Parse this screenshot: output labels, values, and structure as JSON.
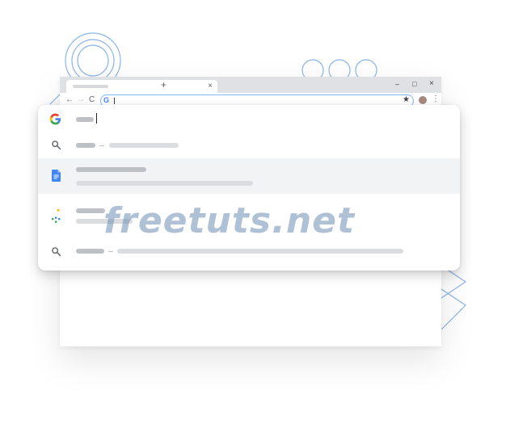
{
  "browser": {
    "tab_close_glyph": "×",
    "new_tab_glyph": "+",
    "window_controls": {
      "minimize_glyph": "–",
      "maximize_glyph": "□",
      "close_glyph": "×"
    },
    "toolbar": {
      "back_icon": "←",
      "forward_icon": "→",
      "reload_icon": "C",
      "omnibox_logo": "G",
      "bookmark_icon": "★",
      "menu_icon": "⋮"
    }
  },
  "suggestions": [
    {
      "icon": "google-g-icon",
      "type": "typed-input"
    },
    {
      "icon": "search-icon",
      "type": "search-suggestion"
    },
    {
      "icon": "google-docs-icon",
      "type": "document-suggestion",
      "highlighted": true
    },
    {
      "icon": "google-photos-icon",
      "type": "photo-suggestion"
    },
    {
      "icon": "search-icon",
      "type": "search-suggestion"
    }
  ],
  "watermark": {
    "text": "freetuts.net"
  },
  "colors": {
    "accent_blue": "#4285f4",
    "decor_blue": "#8ab4e8",
    "placeholder_dark": "#bdc1c6",
    "placeholder_light": "#dadce0",
    "highlight_row": "#f1f3f4",
    "tabstrip": "#dfe1e5"
  }
}
